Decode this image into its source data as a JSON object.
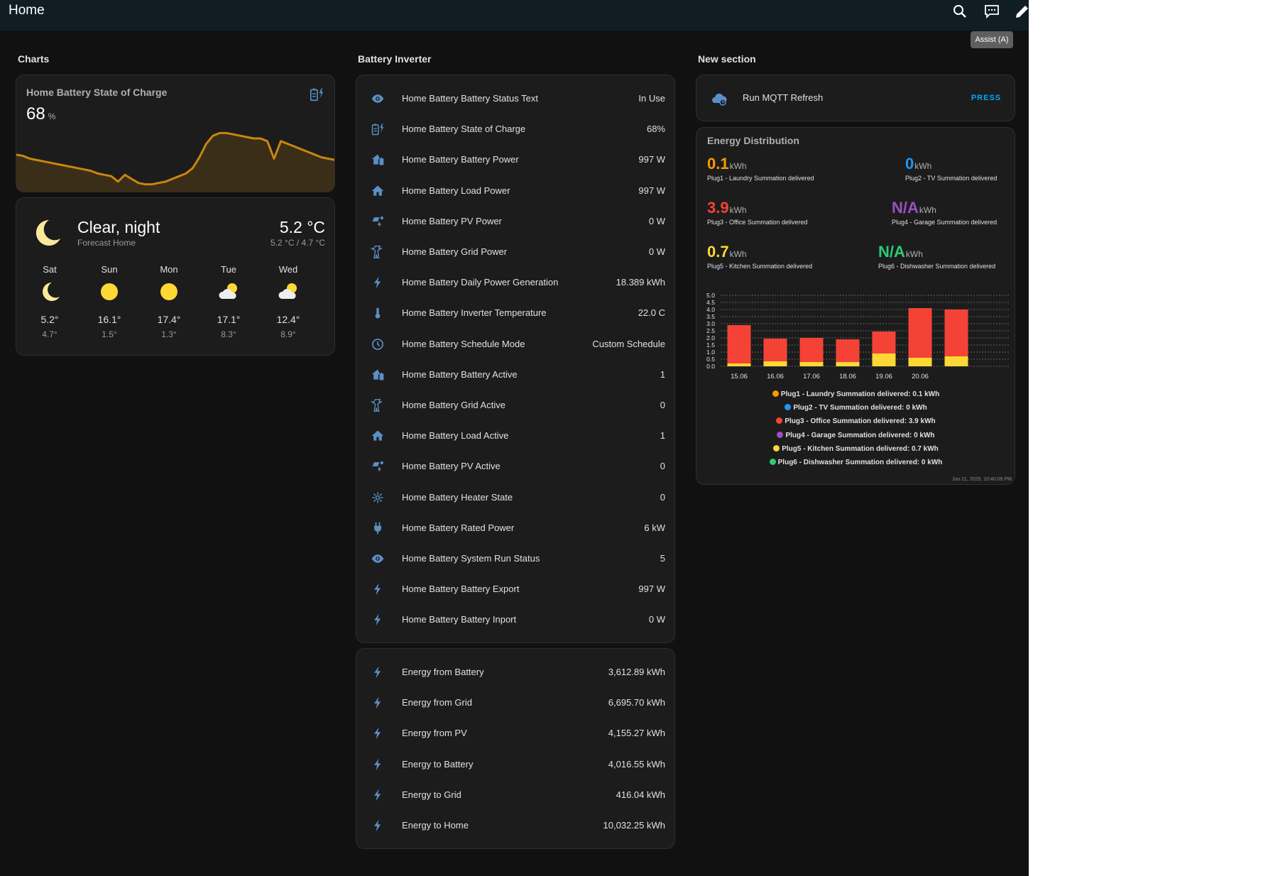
{
  "header": {
    "title": "Home",
    "tooltip": "Assist (A)",
    "icons": [
      "search-icon",
      "assist-chat-icon",
      "edit-pencil-icon"
    ]
  },
  "sections": {
    "charts": "Charts",
    "battery": "Battery Inverter",
    "new": "New section"
  },
  "soc": {
    "name": "Home Battery State of Charge",
    "value": "68",
    "unit": "%",
    "color": "#c9860e",
    "trend": [
      58,
      57,
      55,
      54,
      53,
      52,
      51,
      50,
      49,
      48,
      47,
      46,
      44,
      43,
      42,
      38,
      43,
      40,
      37,
      36,
      36,
      37,
      38,
      40,
      42,
      44,
      48,
      56,
      66,
      72,
      74,
      74,
      73,
      72,
      71,
      70,
      70,
      68,
      55,
      68,
      66,
      64,
      62,
      60,
      58,
      56,
      55,
      54
    ]
  },
  "weather": {
    "condition": "Clear, night",
    "location": "Forecast Home",
    "temp": "5.2 °C",
    "range": "5.2 °C / 4.7 °C",
    "forecast": [
      {
        "day": "Sat",
        "icon": "moon",
        "hi": "5.2°",
        "lo": "4.7°"
      },
      {
        "day": "Sun",
        "icon": "sun",
        "hi": "16.1°",
        "lo": "1.5°"
      },
      {
        "day": "Mon",
        "icon": "sun",
        "hi": "17.4°",
        "lo": "1.3°"
      },
      {
        "day": "Tue",
        "icon": "partly-cloudy",
        "hi": "17.1°",
        "lo": "8.3°"
      },
      {
        "day": "Wed",
        "icon": "partly-cloudy",
        "hi": "12.4°",
        "lo": "8.9°"
      }
    ]
  },
  "battery_rows": [
    {
      "icon": "eye",
      "name": "Home Battery Battery Status Text",
      "value": "In Use"
    },
    {
      "icon": "battery-charging",
      "name": "Home Battery State of Charge",
      "value": "68%"
    },
    {
      "icon": "home-battery",
      "name": "Home Battery Battery Power",
      "value": "997 W"
    },
    {
      "icon": "home",
      "name": "Home Battery Load Power",
      "value": "997 W"
    },
    {
      "icon": "solar-power",
      "name": "Home Battery PV Power",
      "value": "0 W"
    },
    {
      "icon": "transmission-tower",
      "name": "Home Battery Grid Power",
      "value": "0 W"
    },
    {
      "icon": "flash",
      "name": "Home Battery Daily Power Generation",
      "value": "18.389 kWh"
    },
    {
      "icon": "thermometer",
      "name": "Home Battery Inverter Temperature",
      "value": "22.0 C"
    },
    {
      "icon": "clock",
      "name": "Home Battery Schedule Mode",
      "value": "Custom Schedule"
    },
    {
      "icon": "home-battery",
      "name": "Home Battery Battery Active",
      "value": "1"
    },
    {
      "icon": "transmission-tower",
      "name": "Home Battery Grid Active",
      "value": "0"
    },
    {
      "icon": "home",
      "name": "Home Battery Load Active",
      "value": "1"
    },
    {
      "icon": "solar-power",
      "name": "Home Battery PV Active",
      "value": "0"
    },
    {
      "icon": "heater",
      "name": "Home Battery Heater State",
      "value": "0"
    },
    {
      "icon": "power-plug",
      "name": "Home Battery Rated Power",
      "value": "6 kW"
    },
    {
      "icon": "eye",
      "name": "Home Battery System Run Status",
      "value": "5"
    },
    {
      "icon": "flash",
      "name": "Home Battery Battery Export",
      "value": "997 W"
    },
    {
      "icon": "flash",
      "name": "Home Battery Battery Inport",
      "value": "0 W"
    }
  ],
  "energy_rows": [
    {
      "icon": "flash",
      "name": "Energy from Battery",
      "value": "3,612.89 kWh"
    },
    {
      "icon": "flash",
      "name": "Energy from Grid",
      "value": "6,695.70 kWh"
    },
    {
      "icon": "flash",
      "name": "Energy from PV",
      "value": "4,155.27 kWh"
    },
    {
      "icon": "flash",
      "name": "Energy to Battery",
      "value": "4,016.55 kWh"
    },
    {
      "icon": "flash",
      "name": "Energy to Grid",
      "value": "416.04 kWh"
    },
    {
      "icon": "flash",
      "name": "Energy to Home",
      "value": "10,032.25 kWh"
    }
  ],
  "mqtt": {
    "icon": "cloud-refresh",
    "name": "Run MQTT Refresh",
    "button": "PRESS"
  },
  "energy_distribution": {
    "title": "Energy Distribution",
    "items": [
      {
        "value": "0.1",
        "unit": "kWh",
        "label": "Plug1 - Laundry Summation delivered",
        "color": "#ff9800"
      },
      {
        "value": "0",
        "unit": "kWh",
        "label": "Plug2 - TV Summation delivered",
        "color": "#2196f3"
      },
      {
        "value": "3.9",
        "unit": "kWh",
        "label": "Plug3 - Office Summation delivered",
        "color": "#f44336"
      },
      {
        "value": "N/A",
        "unit": "kWh",
        "label": "Plug4 - Garage Summation delivered",
        "color": "#9c4fc4"
      },
      {
        "value": "0.7",
        "unit": "kWh",
        "label": "Plug5 - Kitchen Summation delivered",
        "color": "#fdd835"
      },
      {
        "value": "N/A",
        "unit": "kWh",
        "label": "Plug6 - Dishwasher Summation delivered",
        "color": "#2ecc71"
      }
    ],
    "legend": [
      {
        "text": "Plug1 - Laundry Summation delivered: 0.1 kWh",
        "color": "#ff9800"
      },
      {
        "text": "Plug2 - TV Summation delivered: 0 kWh",
        "color": "#2196f3"
      },
      {
        "text": "Plug3 - Office Summation delivered: 3.9 kWh",
        "color": "#f44336"
      },
      {
        "text": "Plug4 - Garage Summation delivered: 0 kWh",
        "color": "#9c4fc4"
      },
      {
        "text": "Plug5 - Kitchen Summation delivered: 0.7 kWh",
        "color": "#fdd835"
      },
      {
        "text": "Plug6 - Dishwasher Summation delivered: 0 kWh",
        "color": "#2ecc71"
      }
    ],
    "timestamp": "Jun 21, 2025, 10:40:09 PM"
  },
  "chart_data": {
    "type": "bar",
    "stacked": true,
    "categories": [
      "15.06",
      "16.06",
      "17.06",
      "18.06",
      "19.06",
      "20.06",
      ""
    ],
    "ylim": [
      0,
      5
    ],
    "y_ticks": [
      "0.0",
      "0.5",
      "1.0",
      "1.5",
      "2.0",
      "2.5",
      "3.0",
      "3.5",
      "4.0",
      "4.5",
      "5.0"
    ],
    "grid": true,
    "series": [
      {
        "name": "Plug5 - Kitchen Summation delivered",
        "color": "#fdd835",
        "values": [
          0.2,
          0.35,
          0.3,
          0.3,
          0.9,
          0.6,
          0.7
        ]
      },
      {
        "name": "Plug3 - Office Summation delivered",
        "color": "#f44336",
        "values": [
          2.7,
          1.6,
          1.7,
          1.6,
          1.55,
          3.5,
          3.3
        ]
      }
    ]
  }
}
